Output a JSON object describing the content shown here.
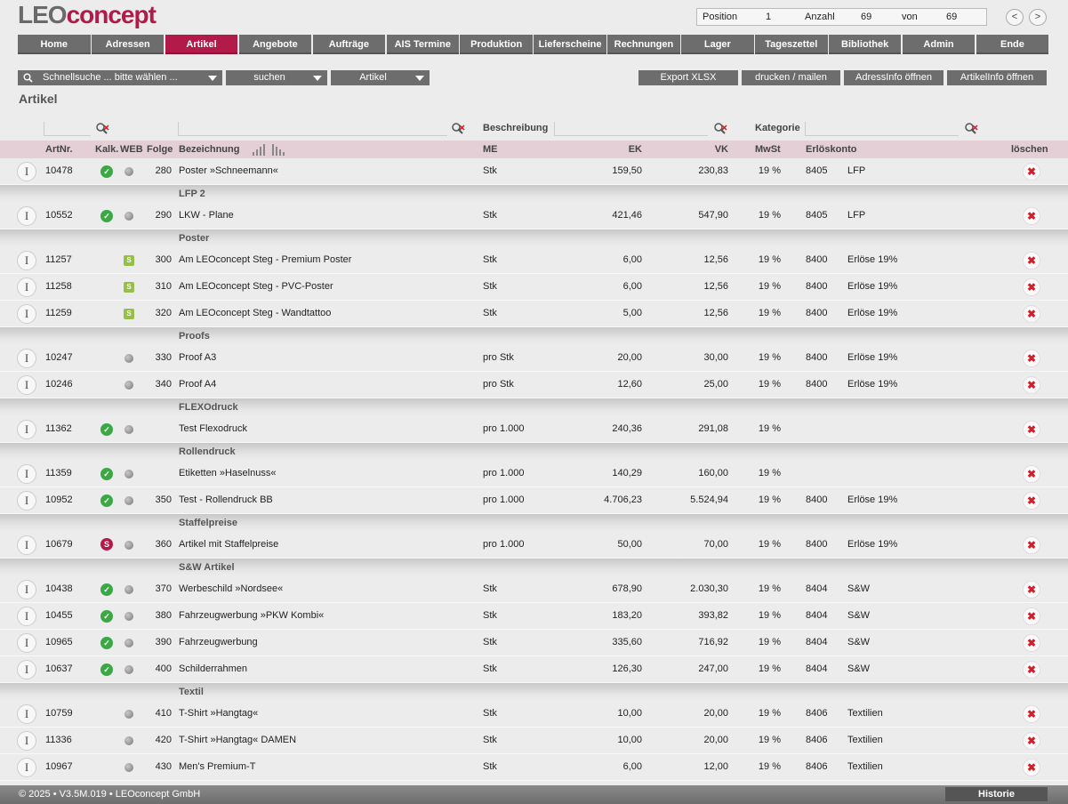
{
  "app": {
    "logo_part1": "LEO",
    "logo_part2": "concept"
  },
  "position": {
    "pos_label": "Position",
    "pos_value": "1",
    "count_label": "Anzahl",
    "count_value": "69",
    "of_label": "von",
    "of_value": "69",
    "prev": "<",
    "next": ">"
  },
  "nav": [
    "Home",
    "Adressen",
    "Artikel",
    "Angebote",
    "Aufträge",
    "AIS Termine",
    "Produktion",
    "Lieferscheine",
    "Rechnungen",
    "Lager",
    "Tageszettel",
    "Bibliothek",
    "Admin",
    "Ende"
  ],
  "nav_active": "Artikel",
  "toolbar": {
    "quicksearch": "Schnellsuche ... bitte wählen ...",
    "search": "suchen",
    "type": "Artikel",
    "export": "Export XLSX",
    "print": "drucken / mailen",
    "addr": "AdressInfo öffnen",
    "art": "ArtikelInfo öffnen"
  },
  "page_title": "Artikel",
  "filters": {
    "desc_label": "Beschreibung",
    "cat_label": "Kategorie"
  },
  "columns": {
    "artnr": "ArtNr.",
    "kalk": "Kalk.",
    "web": "WEB",
    "folge": "Folge",
    "bez": "Bezeichnung",
    "me": "ME",
    "ek": "EK",
    "vk": "VK",
    "mwst": "MwSt",
    "konto": "Erlöskonto",
    "del": "löschen"
  },
  "icons": {
    "info": "info-icon",
    "ok": "check-icon",
    "web": "web-status-icon",
    "shop": "shopify-icon",
    "staffel": "staffel-icon",
    "delete": "delete-icon",
    "search": "search-icon"
  },
  "colors": {
    "accent": "#b21a4a",
    "nav": "#6d6d6d",
    "header": "#e3cfd5",
    "check": "#3aa845"
  },
  "rows": [
    {
      "type": "item",
      "artnr": "10478",
      "kalk": "ok",
      "web": "dot",
      "folge": "280",
      "bez": "Poster »Schneemann«",
      "me": "Stk",
      "ek": "159,50",
      "vk": "230,83",
      "mwst": "19 %",
      "konto": "8405",
      "kname": "LFP"
    },
    {
      "type": "group",
      "label": "LFP 2"
    },
    {
      "type": "item",
      "artnr": "10552",
      "kalk": "ok",
      "web": "dot",
      "folge": "290",
      "bez": "LKW - Plane",
      "me": "Stk",
      "ek": "421,46",
      "vk": "547,90",
      "mwst": "19 %",
      "konto": "8405",
      "kname": "LFP"
    },
    {
      "type": "group",
      "label": "Poster"
    },
    {
      "type": "item",
      "artnr": "11257",
      "kalk": "",
      "web": "shop",
      "folge": "300",
      "bez": "Am LEOconcept Steg - Premium Poster",
      "me": "Stk",
      "ek": "6,00",
      "vk": "12,56",
      "mwst": "19 %",
      "konto": "8400",
      "kname": "Erlöse 19%"
    },
    {
      "type": "item",
      "artnr": "11258",
      "kalk": "",
      "web": "shop",
      "folge": "310",
      "bez": "Am LEOconcept Steg - PVC-Poster",
      "me": "Stk",
      "ek": "6,00",
      "vk": "12,56",
      "mwst": "19 %",
      "konto": "8400",
      "kname": "Erlöse 19%"
    },
    {
      "type": "item",
      "artnr": "11259",
      "kalk": "",
      "web": "shop",
      "folge": "320",
      "bez": "Am LEOconcept Steg - Wandtattoo",
      "me": "Stk",
      "ek": "5,00",
      "vk": "12,56",
      "mwst": "19 %",
      "konto": "8400",
      "kname": "Erlöse 19%"
    },
    {
      "type": "group",
      "label": "Proofs"
    },
    {
      "type": "item",
      "artnr": "10247",
      "kalk": "",
      "web": "dot",
      "folge": "330",
      "bez": "Proof A3",
      "me": "pro Stk",
      "ek": "20,00",
      "vk": "30,00",
      "mwst": "19 %",
      "konto": "8400",
      "kname": "Erlöse 19%"
    },
    {
      "type": "item",
      "artnr": "10246",
      "kalk": "",
      "web": "dot",
      "folge": "340",
      "bez": "Proof A4",
      "me": "pro Stk",
      "ek": "12,60",
      "vk": "25,00",
      "mwst": "19 %",
      "konto": "8400",
      "kname": "Erlöse 19%"
    },
    {
      "type": "group",
      "label": "FLEXOdruck"
    },
    {
      "type": "item",
      "artnr": "11362",
      "kalk": "ok",
      "web": "dot",
      "folge": "",
      "bez": "Test Flexodruck",
      "me": "pro 1.000",
      "ek": "240,36",
      "vk": "291,08",
      "mwst": "19 %",
      "konto": "",
      "kname": ""
    },
    {
      "type": "group",
      "label": "Rollendruck"
    },
    {
      "type": "item",
      "artnr": "11359",
      "kalk": "ok",
      "web": "dot",
      "folge": "",
      "bez": "Etiketten »Haselnuss«",
      "me": "pro 1.000",
      "ek": "140,29",
      "vk": "160,00",
      "mwst": "19 %",
      "konto": "",
      "kname": ""
    },
    {
      "type": "item",
      "artnr": "10952",
      "kalk": "ok",
      "web": "dot",
      "folge": "350",
      "bez": "Test - Rollendruck BB",
      "me": "pro 1.000",
      "ek": "4.706,23",
      "vk": "5.524,94",
      "mwst": "19 %",
      "konto": "8400",
      "kname": "Erlöse 19%"
    },
    {
      "type": "group",
      "label": "Staffelpreise"
    },
    {
      "type": "item",
      "artnr": "10679",
      "kalk": "staffel",
      "web": "dot",
      "folge": "360",
      "bez": "Artikel mit Staffelpreise",
      "me": "pro 1.000",
      "ek": "50,00",
      "vk": "70,00",
      "mwst": "19 %",
      "konto": "8400",
      "kname": "Erlöse 19%"
    },
    {
      "type": "group",
      "label": "S&W Artikel"
    },
    {
      "type": "item",
      "artnr": "10438",
      "kalk": "ok",
      "web": "dot",
      "folge": "370",
      "bez": "Werbeschild »Nordsee«",
      "me": "Stk",
      "ek": "678,90",
      "vk": "2.030,30",
      "mwst": "19 %",
      "konto": "8404",
      "kname": "S&W"
    },
    {
      "type": "item",
      "artnr": "10455",
      "kalk": "ok",
      "web": "dot",
      "folge": "380",
      "bez": "Fahrzeugwerbung »PKW Kombi«",
      "me": "Stk",
      "ek": "183,20",
      "vk": "393,82",
      "mwst": "19 %",
      "konto": "8404",
      "kname": "S&W"
    },
    {
      "type": "item",
      "artnr": "10965",
      "kalk": "ok",
      "web": "dot",
      "folge": "390",
      "bez": "Fahrzeugwerbung",
      "me": "Stk",
      "ek": "335,60",
      "vk": "716,92",
      "mwst": "19 %",
      "konto": "8404",
      "kname": "S&W"
    },
    {
      "type": "item",
      "artnr": "10637",
      "kalk": "ok",
      "web": "dot",
      "folge": "400",
      "bez": "Schilderrahmen",
      "me": "Stk",
      "ek": "126,30",
      "vk": "247,00",
      "mwst": "19 %",
      "konto": "8404",
      "kname": "S&W"
    },
    {
      "type": "group",
      "label": "Textil"
    },
    {
      "type": "item",
      "artnr": "10759",
      "kalk": "",
      "web": "dot",
      "folge": "410",
      "bez": "T-Shirt »Hangtag«",
      "me": "Stk",
      "ek": "10,00",
      "vk": "20,00",
      "mwst": "19 %",
      "konto": "8406",
      "kname": "Textilien"
    },
    {
      "type": "item",
      "artnr": "11336",
      "kalk": "",
      "web": "dot",
      "folge": "420",
      "bez": "T-Shirt »Hangtag« DAMEN",
      "me": "Stk",
      "ek": "10,00",
      "vk": "20,00",
      "mwst": "19 %",
      "konto": "8406",
      "kname": "Textilien"
    },
    {
      "type": "item",
      "artnr": "10967",
      "kalk": "",
      "web": "dot",
      "folge": "430",
      "bez": "Men's Premium-T",
      "me": "Stk",
      "ek": "6,00",
      "vk": "12,00",
      "mwst": "19 %",
      "konto": "8406",
      "kname": "Textilien"
    }
  ],
  "footer": {
    "copyright": "© 2025 • V3.5M.019 • LEOconcept GmbH",
    "history": "Historie"
  }
}
